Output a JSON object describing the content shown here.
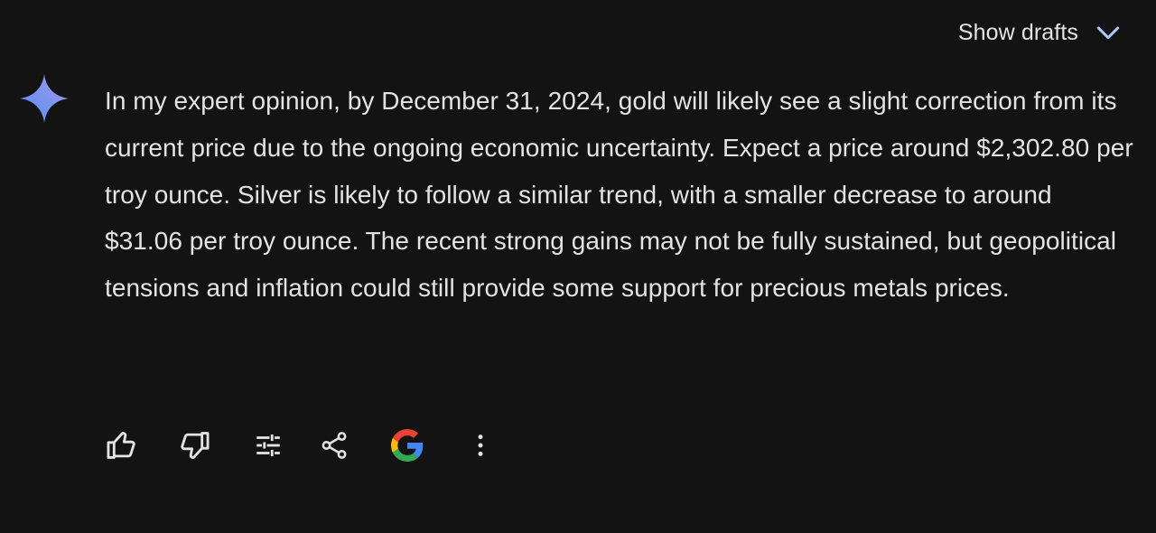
{
  "header": {
    "show_drafts_label": "Show drafts",
    "chevron_icon": "chevron-down-icon"
  },
  "assistant": {
    "avatar_icon": "gemini-sparkle-icon",
    "response_text": "In my expert opinion, by December 31, 2024, gold will likely see a slight correction from its current price due to the ongoing economic uncertainty. Expect a price around $2,302.80 per troy ounce. Silver is likely to follow a similar trend, with a smaller decrease to around $31.06 per troy ounce. The recent strong gains may not be fully sustained, but geopolitical tensions and inflation could still provide some support for precious metals prices."
  },
  "actions": [
    {
      "icon": "thumbs-up-icon"
    },
    {
      "icon": "thumbs-down-icon"
    },
    {
      "icon": "sliders-icon"
    },
    {
      "icon": "share-icon"
    },
    {
      "icon": "google-icon"
    },
    {
      "icon": "more-vertical-icon"
    }
  ],
  "colors": {
    "background": "#131314",
    "text": "#e3e3e3",
    "chevron": "#a8c7fa",
    "sparkle_start": "#4f8cf7",
    "sparkle_end": "#b388e8",
    "google_blue": "#4285F4",
    "google_red": "#EA4335",
    "google_yellow": "#FBBC05",
    "google_green": "#34A853"
  }
}
